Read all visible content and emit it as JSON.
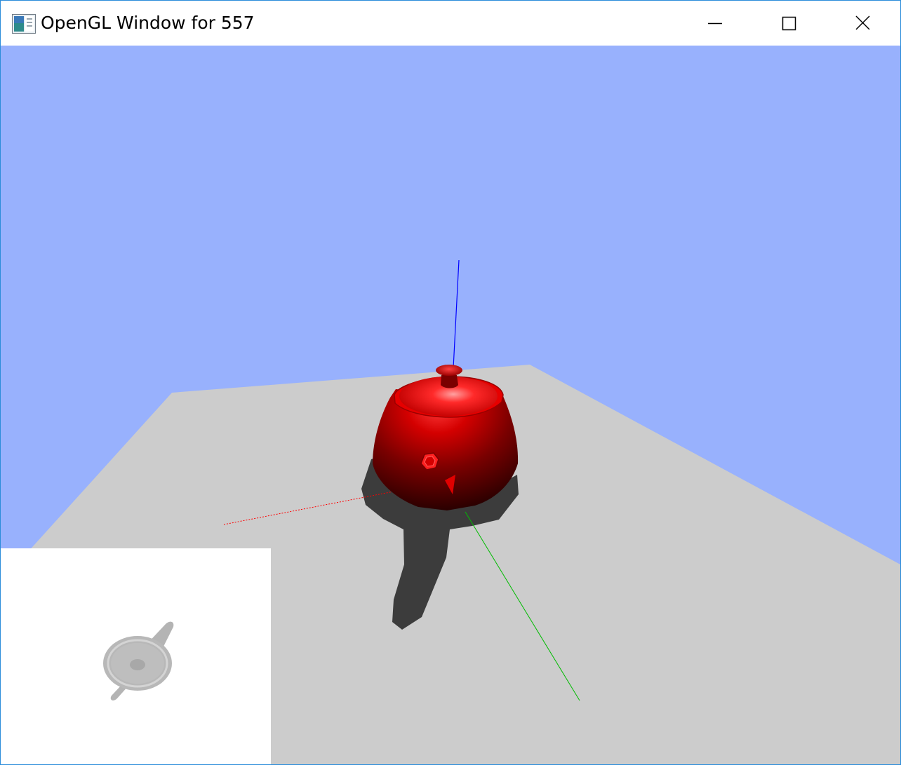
{
  "window": {
    "title": "OpenGL Window for 557",
    "app_icon": "opengl-app-icon",
    "controls": {
      "minimize": "minimize-icon",
      "maximize": "maximize-icon",
      "close": "close-icon"
    }
  },
  "scene": {
    "sky_color": "#98b1fd",
    "floor_color": "#cccccc",
    "shadow_color": "#3c3c3c",
    "teapot_color": "#cc0000",
    "axes": {
      "x_color": "#ff0000",
      "y_color": "#00cc00",
      "z_color": "#0000ff"
    }
  },
  "minimap": {
    "background": "#ffffff",
    "object_color": "#b4b4b4"
  }
}
